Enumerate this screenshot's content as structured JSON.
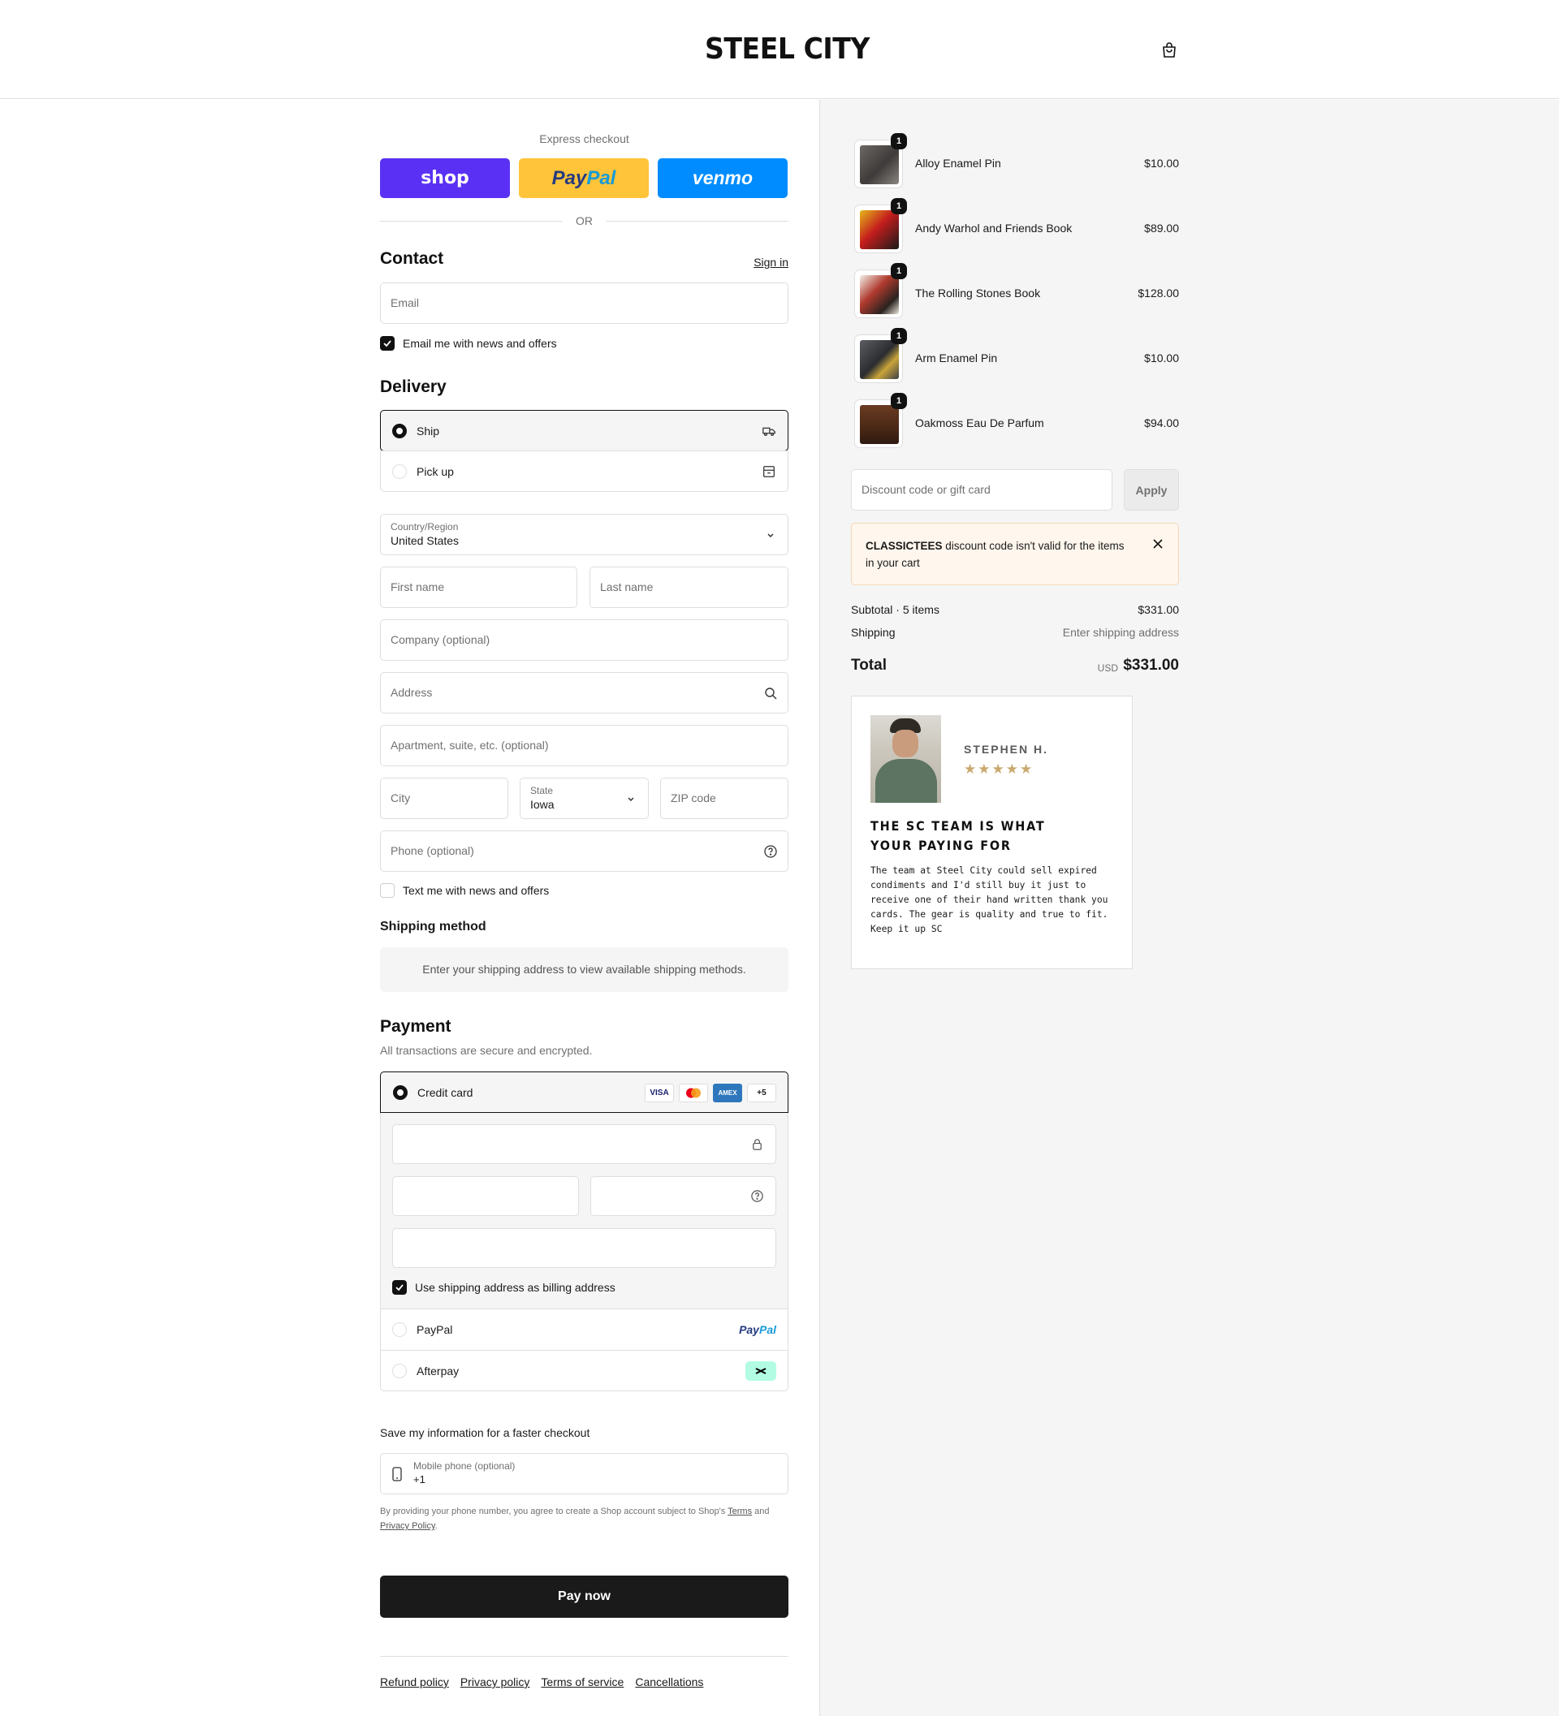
{
  "header": {
    "logo": "STEEL CITY",
    "cart_icon": "shopping-bag-icon"
  },
  "express": {
    "label": "Express checkout",
    "shop_label": "shop",
    "paypal_label_1": "Pay",
    "paypal_label_2": "Pal",
    "venmo_label": "venmo",
    "or_label": "OR"
  },
  "contact": {
    "title": "Contact",
    "sign_in": "Sign in",
    "email_placeholder": "Email",
    "news_checkbox": "Email me with news and offers",
    "news_checked": true
  },
  "delivery": {
    "title": "Delivery",
    "options": [
      {
        "label": "Ship",
        "selected": true,
        "icon": "truck-icon"
      },
      {
        "label": "Pick up",
        "selected": false,
        "icon": "store-icon"
      }
    ],
    "country_label": "Country/Region",
    "country_value": "United States",
    "first_name": "First name",
    "last_name": "Last name",
    "company": "Company (optional)",
    "address": "Address",
    "apartment": "Apartment, suite, etc. (optional)",
    "city": "City",
    "state_label": "State",
    "state_value": "Iowa",
    "zip": "ZIP code",
    "phone": "Phone (optional)",
    "text_checkbox": "Text me with news and offers",
    "text_checked": false
  },
  "shipping_method": {
    "title": "Shipping method",
    "note": "Enter your shipping address to view available shipping methods."
  },
  "payment": {
    "title": "Payment",
    "subtitle": "All transactions are secure and encrypted.",
    "credit_card": "Credit card",
    "card_logos": [
      "VISA",
      "mastercard",
      "AMEX",
      "+5"
    ],
    "billing_checkbox": "Use shipping address as billing address",
    "billing_checked": true,
    "paypal": "PayPal",
    "paypal_logo_1": "Pay",
    "paypal_logo_2": "Pal",
    "afterpay": "Afterpay"
  },
  "save_info": {
    "title": "Save my information for a faster checkout",
    "mobile_label": "Mobile phone (optional)",
    "mobile_value": "+1",
    "legal_1": "By providing your phone number, you agree to create a Shop account subject to Shop's ",
    "legal_terms": "Terms",
    "legal_2": " and ",
    "legal_privacy": "Privacy Policy",
    "legal_3": "."
  },
  "pay_now": "Pay now",
  "footer": {
    "links": [
      "Refund policy",
      "Privacy policy",
      "Terms of service",
      "Cancellations"
    ]
  },
  "cart": {
    "items": [
      {
        "name": "Alloy Enamel Pin",
        "price": "$10.00",
        "qty": "1"
      },
      {
        "name": "Andy Warhol and Friends Book",
        "price": "$89.00",
        "qty": "1"
      },
      {
        "name": "The Rolling Stones Book",
        "price": "$128.00",
        "qty": "1"
      },
      {
        "name": "Arm Enamel Pin",
        "price": "$10.00",
        "qty": "1"
      },
      {
        "name": "Oakmoss Eau De Parfum",
        "price": "$94.00",
        "qty": "1"
      }
    ],
    "discount_placeholder": "Discount code or gift card",
    "apply": "Apply",
    "alert_code": "CLASSICTEES",
    "alert_text": " discount code isn't valid for the items in your cart",
    "subtotal_label": "Subtotal · 5 items",
    "subtotal_value": "$331.00",
    "shipping_label": "Shipping",
    "shipping_value": "Enter shipping address",
    "total_label": "Total",
    "total_currency": "USD",
    "total_value": "$331.00"
  },
  "review": {
    "name": "STEPHEN H.",
    "stars": "★★★★★",
    "rating": 5,
    "title": "THE SC TEAM IS WHAT YOUR PAYING FOR",
    "body": "The team at Steel City could sell expired condiments and I'd still buy it just to receive one of their hand written thank you cards. The gear is quality and true to fit. Keep it up SC"
  }
}
